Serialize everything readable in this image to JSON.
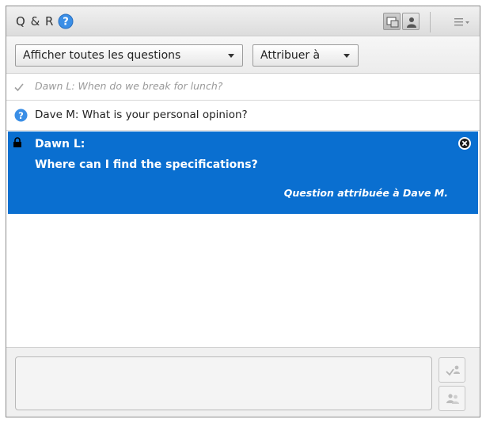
{
  "header": {
    "title": "Q & R",
    "icons": [
      "help-icon",
      "presenter-view-icon",
      "participant-view-icon",
      "pod-menu-icon"
    ]
  },
  "filters": {
    "show_filter": "Afficher toutes les questions",
    "assign_filter": "Attribuer à"
  },
  "questions": [
    {
      "status": "answered",
      "text": "Dawn L: When do we break for lunch?"
    },
    {
      "status": "open",
      "text": "Dave M: What is your personal opinion?"
    },
    {
      "status": "selected",
      "author": "Dawn L:",
      "text": "Where can I find the specifications?",
      "assigned": "Question attribuée à Dave M."
    }
  ],
  "composer": {
    "placeholder": "",
    "send_icon": "send-answer-icon",
    "send_private_icon": "send-private-icon"
  },
  "colors": {
    "selected_row": "#0a6fd0",
    "help_blue": "#3a8ee6"
  }
}
